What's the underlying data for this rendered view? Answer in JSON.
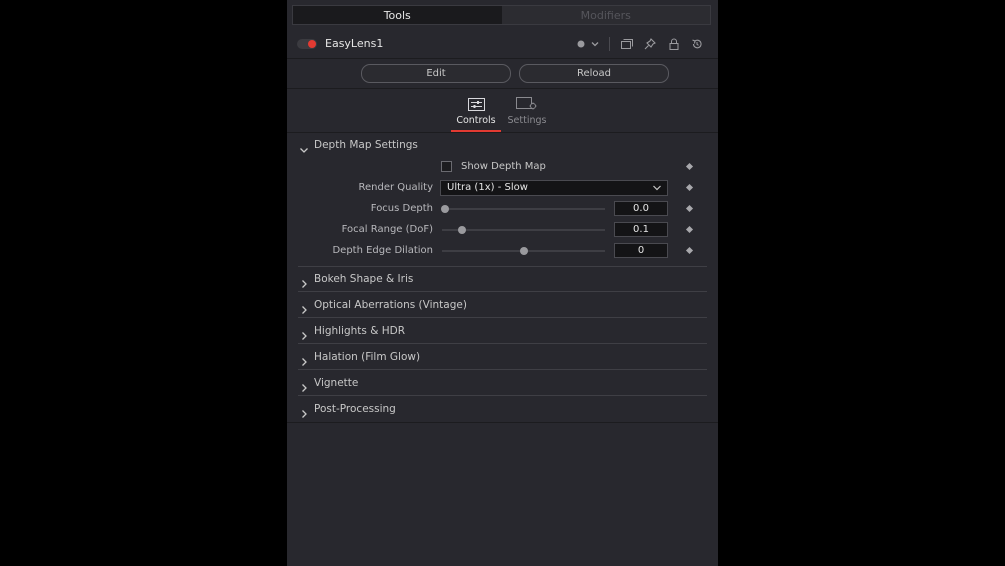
{
  "tabs": {
    "tools": "Tools",
    "modifiers": "Modifiers"
  },
  "tool": {
    "name": "EasyLens1",
    "enabled_color": "#e23a32"
  },
  "buttons": {
    "edit": "Edit",
    "reload": "Reload"
  },
  "control_tabs": {
    "controls": "Controls",
    "settings": "Settings"
  },
  "sections": [
    {
      "title": "Depth Map Settings",
      "expanded": true
    },
    {
      "title": "Bokeh Shape & Iris",
      "expanded": false
    },
    {
      "title": "Optical Aberrations (Vintage)",
      "expanded": false
    },
    {
      "title": "Highlights & HDR",
      "expanded": false
    },
    {
      "title": "Halation (Film Glow)",
      "expanded": false
    },
    {
      "title": "Vignette",
      "expanded": false
    },
    {
      "title": "Post-Processing",
      "expanded": false
    }
  ],
  "depth": {
    "show_depth_map": {
      "label": "Show Depth Map",
      "checked": false
    },
    "render_quality": {
      "label": "Render Quality",
      "value": "Ultra (1x) - Slow"
    },
    "focus_depth": {
      "label": "Focus Depth",
      "value": "0.0",
      "fraction": 0.02
    },
    "focal_range": {
      "label": "Focal Range (DoF)",
      "value": "0.1",
      "fraction": 0.12
    },
    "edge_dilation": {
      "label": "Depth Edge Dilation",
      "value": "0",
      "fraction": 0.5
    }
  },
  "accent_color": "#e23a32"
}
